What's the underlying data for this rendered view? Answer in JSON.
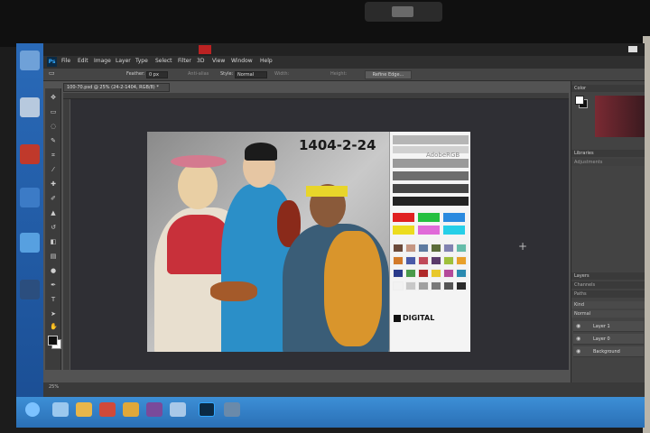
{
  "app": {
    "name": "Adobe Photoshop",
    "menu": [
      "File",
      "Edit",
      "Image",
      "Layer",
      "Type",
      "Select",
      "Filter",
      "3D",
      "View",
      "Window",
      "Help"
    ]
  },
  "options_bar": {
    "feather_label": "Feather:",
    "feather_value": "0 px",
    "anti_alias": "Anti-alias",
    "style_label": "Style:",
    "style_value": "Normal",
    "width_label": "Width:",
    "height_label": "Height:",
    "refine_button": "Refine Edge..."
  },
  "document": {
    "tab_title": "100-70.psd @ 25% (24-2-1404, RGB/8) *",
    "photo_label": "1404-2-24",
    "chart_brand": "AdobeRGB",
    "chart_logo_text": "DIGITAL"
  },
  "panels": {
    "color_tab": "Color",
    "libraries_tab": "Libraries",
    "adjustments_tab": "Adjustments",
    "layers_tab": "Layers",
    "channels_tab": "Channels",
    "paths_tab": "Paths",
    "kind_label": "Kind",
    "normal_label": "Normal",
    "layers": [
      "Layer 1",
      "Layer 0",
      "Background"
    ]
  },
  "status": {
    "zoom": "25%"
  },
  "colors": {
    "app_bg": "#535353",
    "panel_bg": "#434343",
    "menubar_bg": "#2f2f2f",
    "taskbar": "#2a6fb5",
    "accent": "#31a8ff"
  }
}
